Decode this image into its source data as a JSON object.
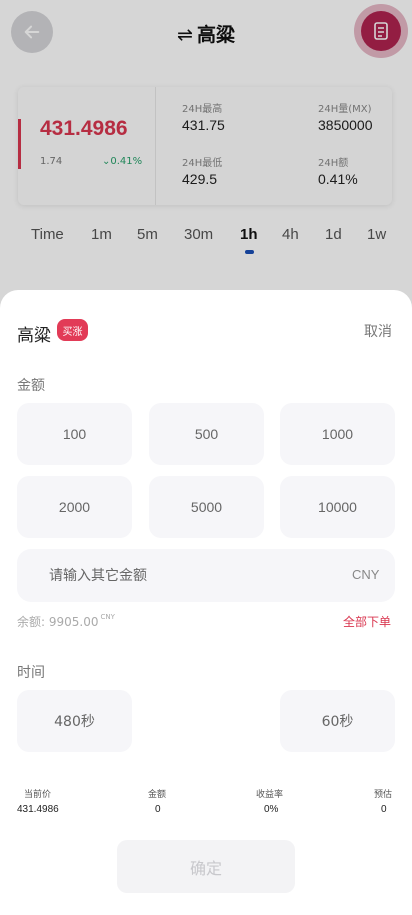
{
  "header": {
    "swap_symbol": "⇌",
    "title": "高粱",
    "back_icon": "arrow-left-icon",
    "orders_icon": "document-icon"
  },
  "quote": {
    "price": "431.4986",
    "change": "1.74",
    "change_pct": "0.41%",
    "high_label": "24H最高",
    "high_value": "431.75",
    "volume_label": "24H量(MX)",
    "volume_value": "3850000",
    "low_label": "24H最低",
    "low_value": "429.5",
    "amount_label": "24H额",
    "amount_value": "0.41%"
  },
  "timeframes": [
    "Time",
    "1m",
    "5m",
    "30m",
    "1h",
    "4h",
    "1d",
    "1w"
  ],
  "active_timeframe": "1h",
  "sheet": {
    "title": "高粱",
    "badge": "买涨",
    "cancel": "取消",
    "amount_label": "金额",
    "amounts": [
      "100",
      "500",
      "1000",
      "2000",
      "5000",
      "10000"
    ],
    "custom_placeholder": "请输入其它金额",
    "custom_unit": "CNY",
    "balance_label": "余额:",
    "balance_value": "9905.00",
    "balance_currency": "CNY",
    "all_in": "全部下单",
    "time_label": "时间",
    "times": [
      "480秒",
      "60秒"
    ],
    "summary": [
      {
        "label": "当前价",
        "value": "431.4986"
      },
      {
        "label": "金额",
        "value": "0"
      },
      {
        "label": "收益率",
        "value": "0%"
      },
      {
        "label": "预估",
        "value": "0"
      }
    ],
    "confirm": "确定"
  },
  "colors": {
    "accent_red": "#d9364f",
    "badge_red": "#e23b57",
    "up_green": "#27a06a",
    "active_blue": "#1a4fb5",
    "order_button": "#b0234f"
  }
}
